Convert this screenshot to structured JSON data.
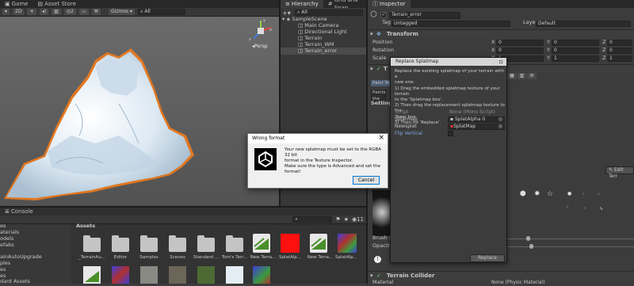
{
  "scene_tabs": {
    "game": "Game",
    "asset_store": "Asset Store"
  },
  "scene_toolbar": {
    "zoom": "2D",
    "gizmos": "Gizmos",
    "search_placeholder": "All",
    "layer_count": "2"
  },
  "scene_view": {
    "persp_label": "Persp",
    "axis_y": "y",
    "axis_x": "x",
    "axis_z": "z"
  },
  "hierarchy": {
    "tabs": [
      "Hierarchy",
      "Grid and Snap"
    ],
    "search_placeholder": "All",
    "scene": "SampleScene",
    "items": [
      "Main Camera",
      "Directional Light",
      "Terrain",
      "Terrain_WM",
      "Terrain_error"
    ]
  },
  "inspector": {
    "tab": "Inspector",
    "object_name": "Terrain_error",
    "tag_label": "Tag",
    "tag_value": "Untagged",
    "layer_label": "Layer",
    "layer_value": "Default",
    "transform_title": "Transform",
    "position": {
      "label": "Position",
      "x": "0",
      "y": "0",
      "z": "0"
    },
    "rotation": {
      "label": "Rotation",
      "x": "0",
      "y": "0",
      "z": "0"
    },
    "scale": {
      "label": "Scale",
      "x": "1",
      "y": "1",
      "z": "1"
    },
    "terrain_prefix": "T",
    "paint_tex_label": "Paint Te",
    "paints_label": "Paints the",
    "settings_label": "Settings",
    "edit_terrain_button": "Edit Terr",
    "brush_size_label": "Brush Siz",
    "opacity_label": "Opacity",
    "terrain_collider_title": "Terrain Collider",
    "material_label": "Material",
    "material_value": "None (Physic Material)"
  },
  "splatmap_window": {
    "title": "Replace Splatmap",
    "instructions": [
      "Replace the existing splatmap of your terrain with a",
      "new one.",
      "1) Drag the embedded splatmap texture of your terrain",
      "to the 'Splatmap box'.",
      "2) Then drag the replacement splatmap texture to the",
      "'New' box",
      "3) Then hit 'Replace'."
    ],
    "script_label": "Script",
    "script_value": "None (Mono Script)",
    "splatmap_label": "Splatmap",
    "splatmap_value": "SplatAlpha 0",
    "newsplat_label": "Newsplat",
    "newsplat_value": "SplatMap",
    "flip_label": "Flip Vertical",
    "replace_button": "Replace"
  },
  "wrong_format_dialog": {
    "title": "Wrong format",
    "message": [
      "Your new splatmap must be set to the RGBA 32 bit",
      "format in the Texture Inspector.",
      "Make sure the type is Advanced and set the format!"
    ],
    "cancel_button": "Cancel",
    "close_glyph": "×"
  },
  "project": {
    "console_tab": "Console",
    "assets_header": "Assets",
    "tree_items": [
      "es",
      "aterials",
      "odels",
      "efabs",
      "ainAutoUpgrade",
      "ples",
      "es",
      "es",
      "dard Assets"
    ],
    "assets_row1": [
      "_TerrainAu...",
      "Editor",
      "Samples",
      "Scenes",
      "Standard ...",
      "Tom's Terr...",
      "New Terra...",
      "SplatAlp...",
      "New Terra...",
      "SplatAlp..."
    ],
    "count_label": "11"
  },
  "colors": {
    "accent": "#3d6ea8",
    "dialog_bg": "#f0f0f0",
    "terrain_white": "#e4eef6",
    "red_asset": "#ff1010",
    "green_tex": "#4a8f2a"
  }
}
